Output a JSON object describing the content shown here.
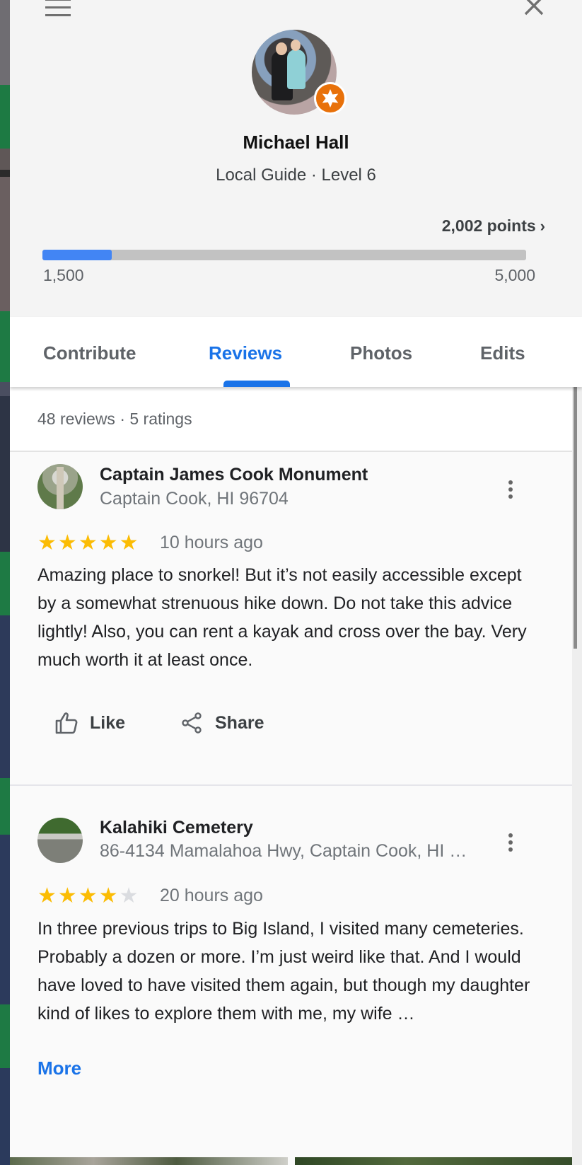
{
  "header": {
    "menu_icon": "hamburger-menu-icon",
    "close_icon": "close-icon",
    "profile": {
      "name": "Michael Hall",
      "level_text": "Local Guide · Level 6",
      "badge_icon": "local-guide-star-icon",
      "badge_color": "#e8710a"
    },
    "points": {
      "label": "2,002 points",
      "chevron": "›",
      "value": 2002,
      "range_min_label": "1,500",
      "range_max_label": "5,000",
      "range_min": 1500,
      "range_max": 5000,
      "progress_fraction": 0.143,
      "bar_color": "#4285f4"
    }
  },
  "tabs": {
    "items": [
      {
        "label": "Contribute",
        "active": false
      },
      {
        "label": "Reviews",
        "active": true
      },
      {
        "label": "Photos",
        "active": false
      },
      {
        "label": "Edits",
        "active": false
      }
    ],
    "accent_color": "#1a73e8"
  },
  "summary": {
    "text": "48 reviews · 5 ratings"
  },
  "reviews": [
    {
      "place_name": "Captain James Cook Monument",
      "address": "Captain Cook, HI 96704",
      "rating": 5,
      "max_rating": 5,
      "time": "10 hours ago",
      "text": "Amazing place to snorkel! But it’s not easily accessible except by a somewhat strenuous hike down. Do not take this advice lightly! Also, you can rent a kayak and cross over the bay. Very much worth it at least once.",
      "actions": {
        "like_label": "Like",
        "share_label": "Share"
      }
    },
    {
      "place_name": "Kalahiki Cemetery",
      "address": "86-4134 Mamalahoa Hwy, Captain Cook, HI …",
      "rating": 4,
      "max_rating": 5,
      "time": "20 hours ago",
      "text": "In three previous trips to Big Island, I visited many cemeteries. Probably a dozen or more. I’m just weird like that. And I would have loved to have visited them again, but though my daughter kind of likes to explore them with me, my wife …",
      "more_label": "More"
    }
  ],
  "colors": {
    "star_filled": "#fbbc04",
    "star_empty": "#dadce0",
    "link": "#1a73e8"
  }
}
